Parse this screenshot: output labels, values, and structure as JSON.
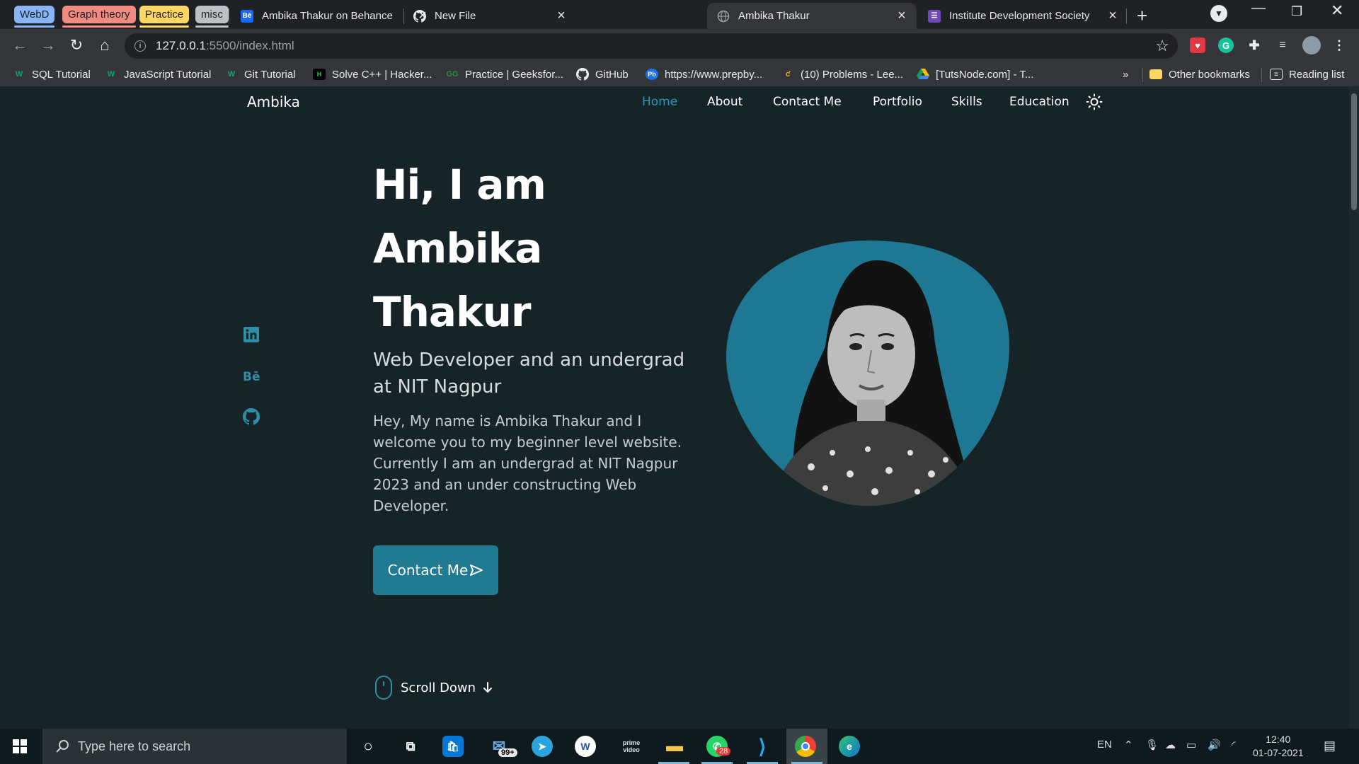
{
  "browser": {
    "tab_groups": [
      {
        "label": "WebD",
        "color": "#8ab4f8"
      },
      {
        "label": "Graph theory",
        "color": "#f28b82"
      },
      {
        "label": "Practice",
        "color": "#fdd663"
      },
      {
        "label": "misc",
        "color": "#bdc1c6"
      }
    ],
    "tabs": [
      {
        "title": "Ambika Thakur on Behance",
        "favicon": "behance-icon",
        "close": "×"
      },
      {
        "title": "New File",
        "favicon": "github-icon",
        "close": "×"
      },
      {
        "title": "Ambika Thakur",
        "favicon": "globe-icon",
        "close": "×"
      },
      {
        "title": "Institute Development Society",
        "favicon": "forms-icon",
        "close": "×"
      }
    ],
    "new_tab": "+",
    "url_host": "127.0.0.1",
    "url_path": ":5500/index.html",
    "bookmarks": [
      {
        "label": "SQL Tutorial",
        "icon": "w3schools-icon"
      },
      {
        "label": "JavaScript Tutorial",
        "icon": "w3schools-icon"
      },
      {
        "label": "Git Tutorial",
        "icon": "w3schools-icon"
      },
      {
        "label": "Solve C++ | Hacker...",
        "icon": "hackerrank-icon"
      },
      {
        "label": "Practice | Geeksfor...",
        "icon": "gfg-icon"
      },
      {
        "label": "GitHub",
        "icon": "github-icon"
      },
      {
        "label": "https://www.prepby...",
        "icon": "prepbytes-icon"
      },
      {
        "label": "(10) Problems - Lee...",
        "icon": "leetcode-icon"
      },
      {
        "label": "[TutsNode.com] - T...",
        "icon": "drive-icon"
      }
    ],
    "bookmarks_overflow": "»",
    "other_bookmarks": "Other bookmarks",
    "reading_list": "Reading list"
  },
  "site": {
    "brand": "Ambika",
    "nav": [
      "Home",
      "About",
      "Contact Me",
      "Portfolio",
      "Skills",
      "Education"
    ],
    "hero": {
      "title_lines": [
        "Hi, I am",
        "Ambika",
        "Thakur"
      ],
      "subtitle": "Web Developer and an undergrad at NIT Nagpur",
      "description": "Hey, My name is Ambika Thakur and I welcome you to my beginner level website. Currently I am an undergrad at NIT Nagpur 2023 and an under constructing Web Developer.",
      "cta": "Contact Me"
    },
    "social": [
      "linkedin-icon",
      "behance-icon",
      "github-icon"
    ],
    "scroll_down": "Scroll Down",
    "accent": "#2b9ab6",
    "background": "#172427"
  },
  "taskbar": {
    "search_placeholder": "Type here to search",
    "mail_badge": "99+",
    "whatsapp_badge": "28",
    "language": "EN",
    "time": "12:40",
    "date": "01-07-2021"
  }
}
